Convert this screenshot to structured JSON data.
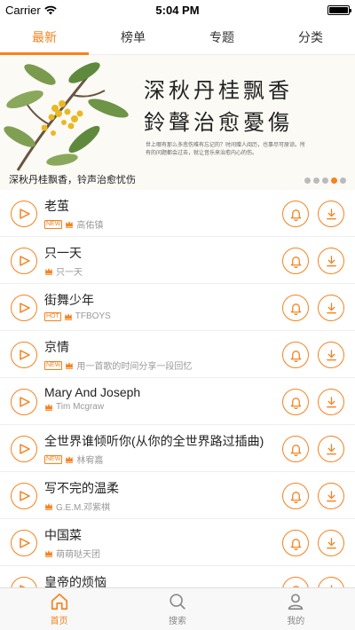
{
  "status": {
    "carrier": "Carrier",
    "time": "5:04 PM",
    "battery_level": 1.0
  },
  "tabs": [
    {
      "label": "最新",
      "active": true
    },
    {
      "label": "榜单",
      "active": false
    },
    {
      "label": "专题",
      "active": false
    },
    {
      "label": "分类",
      "active": false
    }
  ],
  "banner": {
    "heading_line1": "深秋丹桂飘香",
    "heading_line2": "鈴聲治愈憂傷",
    "poem": "世上哪有那么多悲伤难有忘记的？时间赠人阅历，也事尽可原谅。所有的问题都会过去，就让音乐来治愈内心的伤。",
    "caption": "深秋丹桂飘香，铃声治愈忧伤",
    "dots": 5,
    "active_dot": 3
  },
  "songs": [
    {
      "title": "老茧",
      "tag": "NEW",
      "artist": "高佑镇"
    },
    {
      "title": "只一天",
      "tag": "",
      "artist": "只一天"
    },
    {
      "title": "街舞少年",
      "tag": "HOT",
      "artist": "TFBOYS"
    },
    {
      "title": "京情",
      "tag": "NEW",
      "artist": "用一首歌的时间分享一段回忆"
    },
    {
      "title": "Mary And Joseph",
      "tag": "",
      "artist": "Tim Mcgraw"
    },
    {
      "title": "全世界谁倾听你(从你的全世界路过插曲)",
      "tag": "NEW",
      "artist": "林宥嘉"
    },
    {
      "title": "写不完的温柔",
      "tag": "",
      "artist": "G.E.M.邓紫棋"
    },
    {
      "title": "中国菜",
      "tag": "",
      "artist": "萌萌哒天团"
    },
    {
      "title": "皇帝的烦恼",
      "tag": "",
      "artist": ""
    }
  ],
  "bottom_nav": [
    {
      "label": "首页",
      "icon": "home-icon",
      "active": true
    },
    {
      "label": "搜索",
      "icon": "search-icon",
      "active": false
    },
    {
      "label": "我的",
      "icon": "user-icon",
      "active": false
    }
  ],
  "colors": {
    "accent": "#f5821f"
  }
}
